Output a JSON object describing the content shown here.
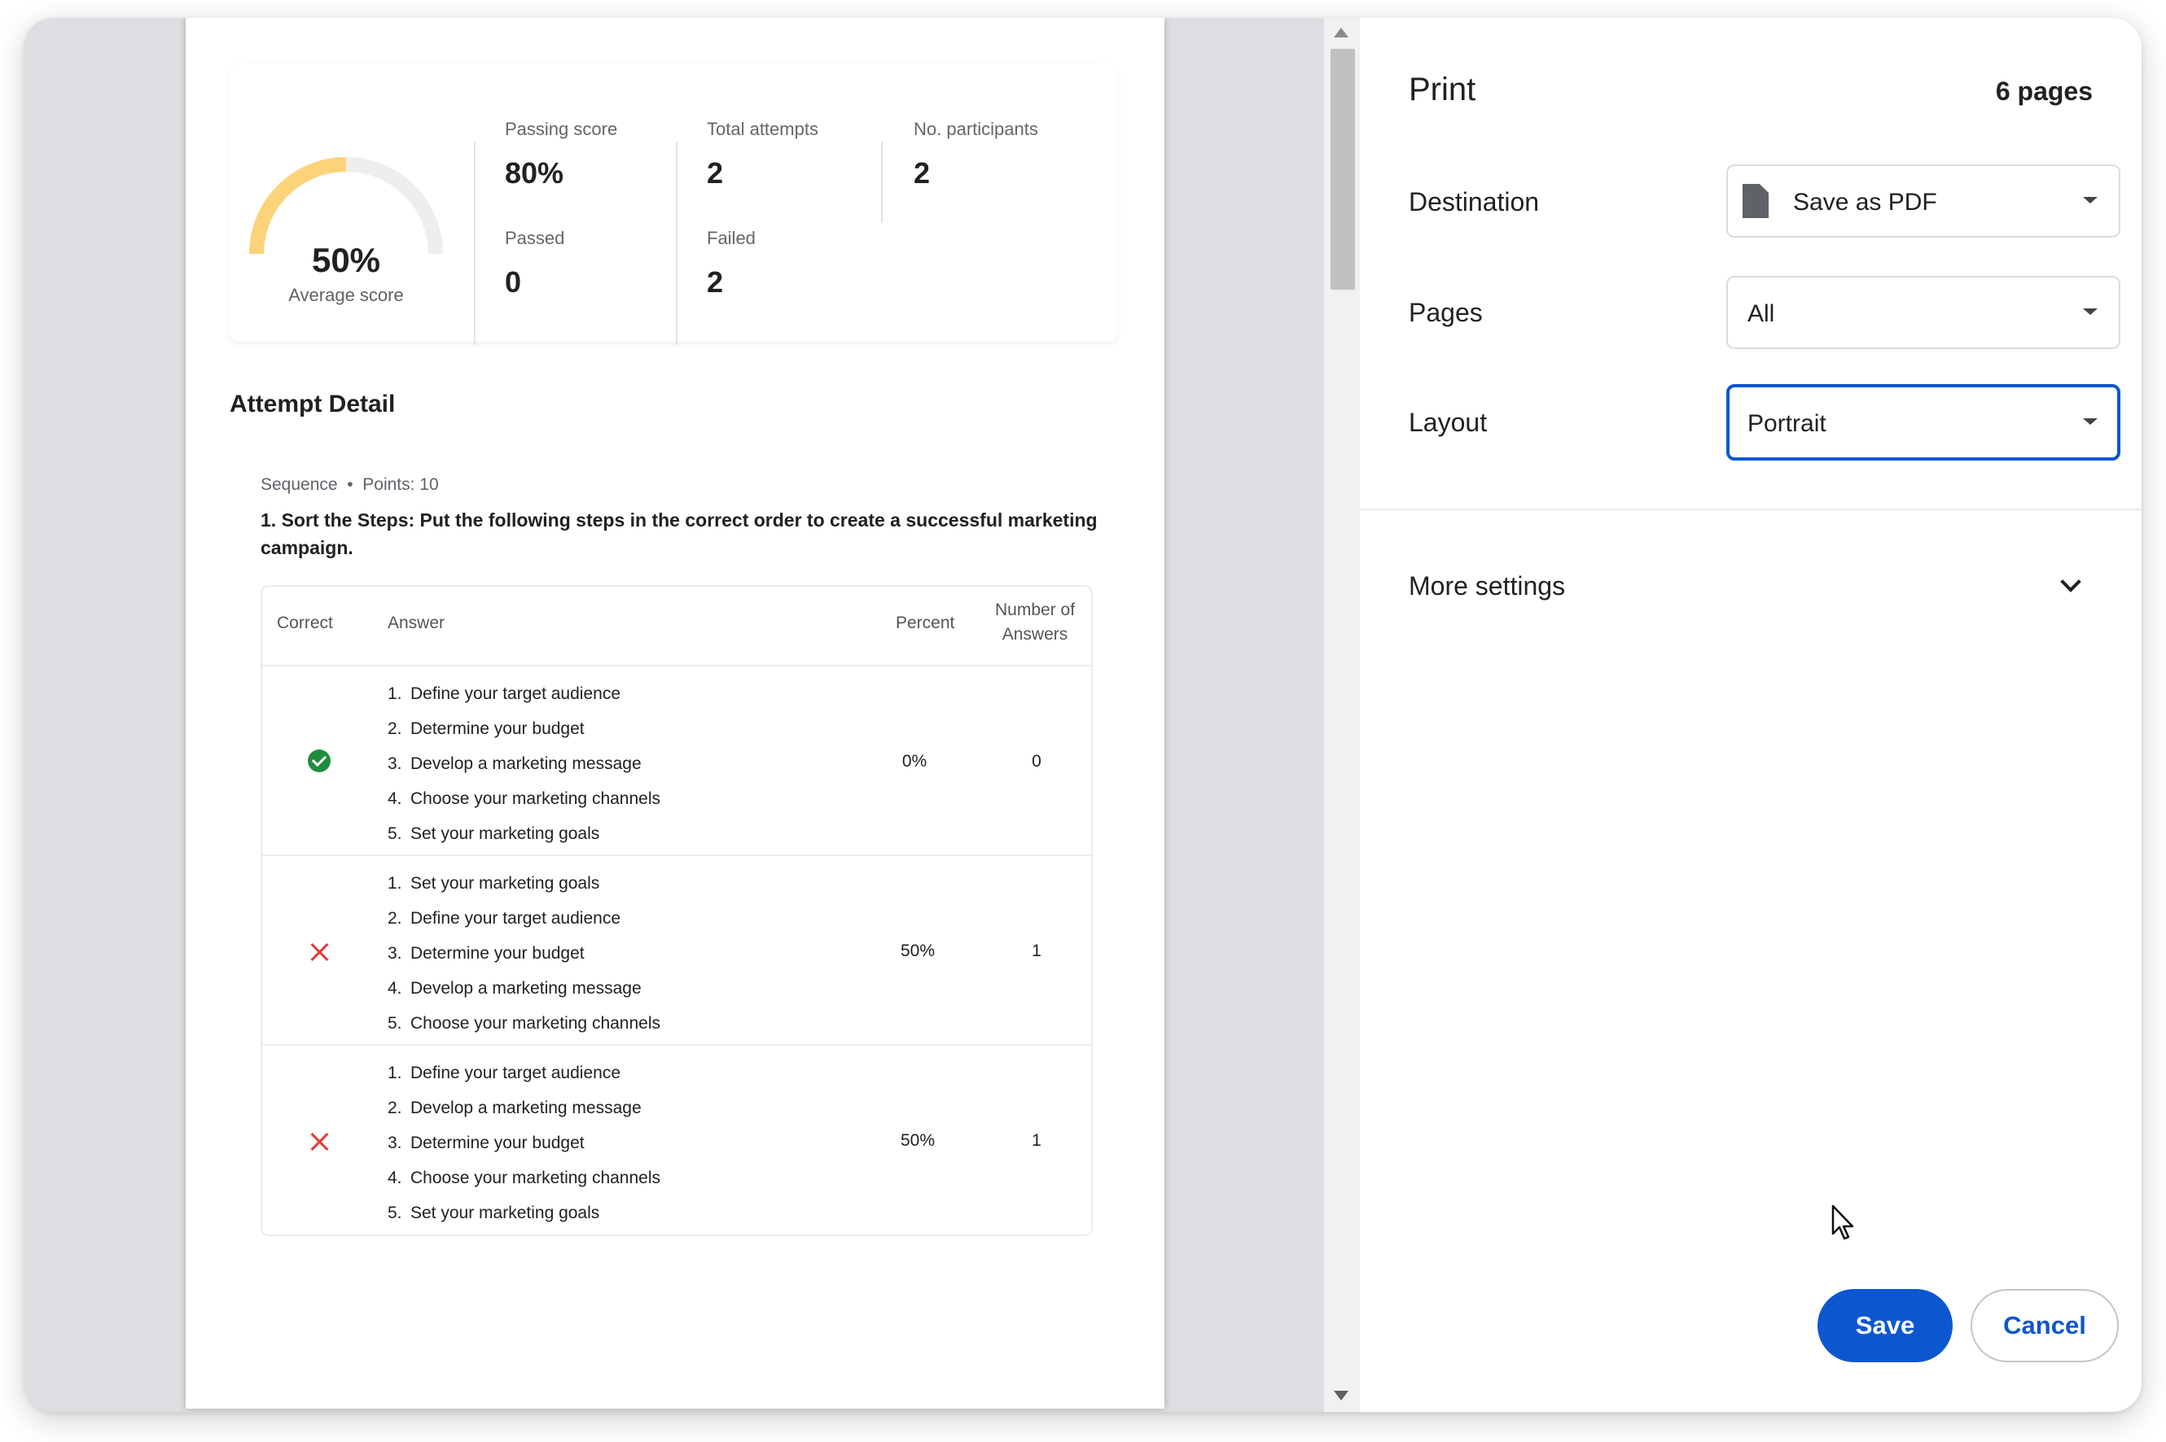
{
  "summary": {
    "average_score": "50%",
    "average_label": "Average score",
    "average_fraction": 0.5,
    "passing_label": "Passing score",
    "passing_value": "80%",
    "attempts_label": "Total attempts",
    "attempts_value": "2",
    "participants_label": "No. participants",
    "participants_value": "2",
    "passed_label": "Passed",
    "passed_value": "0",
    "failed_label": "Failed",
    "failed_value": "2"
  },
  "attempt": {
    "title": "Attempt Detail",
    "meta": "Sequence  •  Points: 10",
    "question": "1. Sort the Steps: Put the following steps in the correct order to create a successful marketing campaign.",
    "headers": {
      "correct": "Correct",
      "answer": "Answer",
      "percent": "Percent",
      "count_line1": "Number of",
      "count_line2": "Answers"
    },
    "rows": [
      {
        "correct": true,
        "percent": "0%",
        "count": "0",
        "steps": [
          "Define your target audience",
          "Determine your budget",
          "Develop a marketing message",
          "Choose your marketing channels",
          "Set your marketing goals"
        ]
      },
      {
        "correct": false,
        "percent": "50%",
        "count": "1",
        "steps": [
          "Set your marketing goals",
          "Define your target audience",
          "Determine your budget",
          "Develop a marketing message",
          "Choose your marketing channels"
        ]
      },
      {
        "correct": false,
        "percent": "50%",
        "count": "1",
        "steps": [
          "Define your target audience",
          "Develop a marketing message",
          "Determine your budget",
          "Choose your marketing channels",
          "Set your marketing goals"
        ]
      }
    ]
  },
  "print": {
    "title": "Print",
    "page_count": "6 pages",
    "destination_label": "Destination",
    "destination_value": "Save as PDF",
    "pages_label": "Pages",
    "pages_value": "All",
    "layout_label": "Layout",
    "layout_value": "Portrait",
    "more_settings": "More settings",
    "save": "Save",
    "cancel": "Cancel"
  },
  "colors": {
    "accent": "#0b57d0",
    "gauge_fill": "#fdd37a",
    "gauge_track": "#eeeeee",
    "correct": "#1e8e3e",
    "incorrect": "#e53935"
  }
}
